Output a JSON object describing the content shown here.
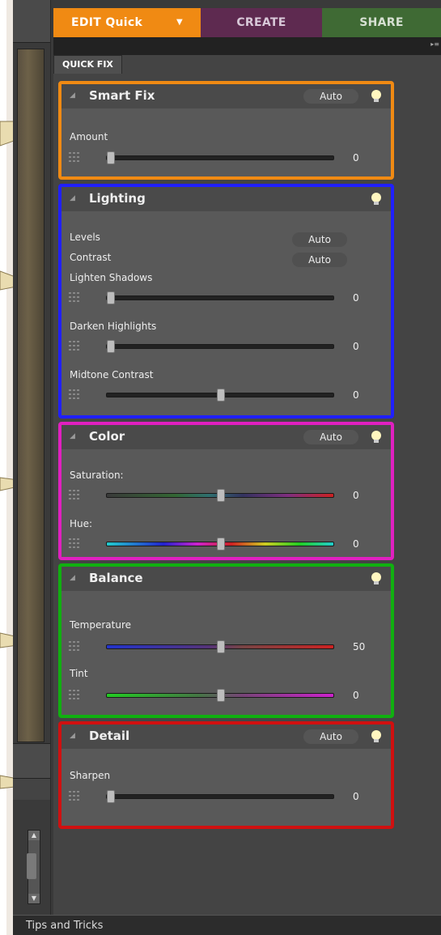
{
  "tabs": {
    "edit": "EDIT Quick",
    "create": "CREATE",
    "share": "SHARE"
  },
  "panel_tab": "QUICK FIX",
  "colors": {
    "edit": "#f08a13",
    "create": "#5e2a50",
    "share": "#3f6a34",
    "smart_fix_border": "#f08a13",
    "lighting_border": "#2020ff",
    "color_border": "#e020c0",
    "balance_border": "#10b010",
    "detail_border": "#d01010"
  },
  "icons": [
    "lightbulb-icon",
    "collapse-triangle-icon",
    "slider-grip-icon",
    "dropdown-caret-icon",
    "scroll-up-icon",
    "scroll-down-icon"
  ],
  "smart_fix": {
    "title": "Smart Fix",
    "auto": "Auto",
    "sliders": [
      {
        "label": "Amount",
        "value": "0",
        "position": 0
      }
    ]
  },
  "lighting": {
    "title": "Lighting",
    "levels": {
      "label": "Levels",
      "auto": "Auto"
    },
    "contrast": {
      "label": "Contrast",
      "auto": "Auto"
    },
    "sliders": [
      {
        "label": "Lighten Shadows",
        "value": "0",
        "position": 0
      },
      {
        "label": "Darken Highlights",
        "value": "0",
        "position": 0
      },
      {
        "label": "Midtone Contrast",
        "value": "0",
        "position": 0.5
      }
    ]
  },
  "color": {
    "title": "Color",
    "auto": "Auto",
    "sliders": [
      {
        "label": "Saturation:",
        "value": "0",
        "position": 0.5
      },
      {
        "label": "Hue:",
        "value": "0",
        "position": 0.5
      }
    ]
  },
  "balance": {
    "title": "Balance",
    "sliders": [
      {
        "label": "Temperature",
        "value": "50",
        "position": 0.5
      },
      {
        "label": "Tint",
        "value": "0",
        "position": 0.5
      }
    ]
  },
  "detail": {
    "title": "Detail",
    "auto": "Auto",
    "sliders": [
      {
        "label": "Sharpen",
        "value": "0",
        "position": 0
      }
    ]
  },
  "footer": "Tips and Tricks"
}
